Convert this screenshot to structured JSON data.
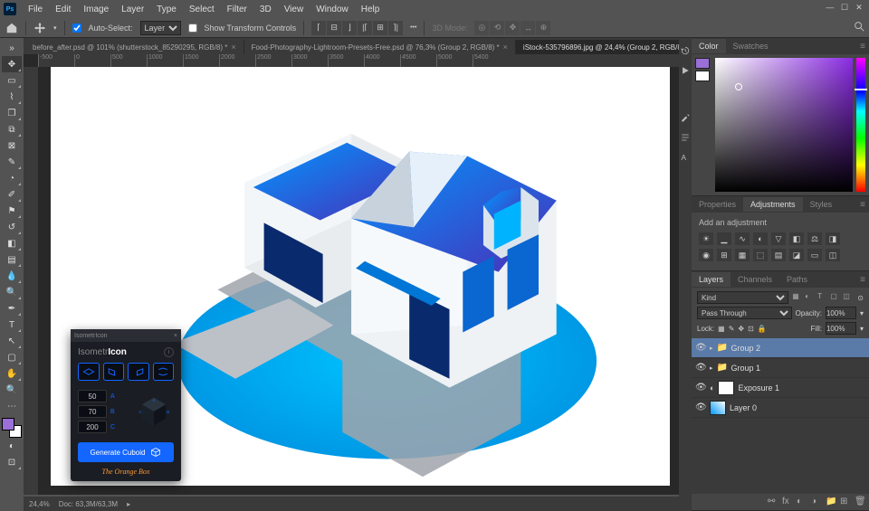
{
  "menu": {
    "items": [
      "File",
      "Edit",
      "Image",
      "Layer",
      "Type",
      "Select",
      "Filter",
      "3D",
      "View",
      "Window",
      "Help"
    ]
  },
  "options": {
    "auto_select": "Auto-Select:",
    "auto_select_mode": "Layer",
    "show_transform": "Show Transform Controls",
    "mode_3d": "3D Mode:"
  },
  "tabs": [
    {
      "label": "before_after.psd @ 101% (shutterstock_85290295, RGB/8) *",
      "active": false
    },
    {
      "label": "Food-Photography-Lightroom-Presets-Free.psd @ 76,3% (Group 2, RGB/8) *",
      "active": false
    },
    {
      "label": "iStock-535796896.jpg @ 24,4% (Group 2, RGB/8) *",
      "active": true
    }
  ],
  "ruler_ticks": [
    "-500",
    "0",
    "500",
    "1000",
    "1500",
    "2000",
    "2500",
    "3000",
    "3500",
    "4000",
    "4500",
    "5000",
    "5400"
  ],
  "plugin": {
    "header": "IsometrIcon",
    "title_light": "Isometr",
    "title_bold": "Icon",
    "dims": {
      "a": "50",
      "b": "70",
      "c": "200"
    },
    "labels": {
      "a": "A",
      "b": "B",
      "c": "C"
    },
    "generate": "Generate Cuboid",
    "footer": "The Orange Box"
  },
  "panels": {
    "color": {
      "tabs": [
        "Color",
        "Swatches"
      ],
      "active": 0
    },
    "adjustments": {
      "tabs": [
        "Properties",
        "Adjustments",
        "Styles"
      ],
      "active": 1,
      "label": "Add an adjustment"
    },
    "layers": {
      "tabs": [
        "Layers",
        "Channels",
        "Paths"
      ],
      "active": 0,
      "kind_label": "Kind",
      "blend_mode": "Pass Through",
      "opacity_label": "Opacity:",
      "opacity": "100%",
      "lock_label": "Lock:",
      "fill_label": "Fill:",
      "fill": "100%",
      "items": [
        {
          "type": "group",
          "name": "Group 2",
          "selected": true,
          "expanded": false
        },
        {
          "type": "group",
          "name": "Group 1",
          "selected": false,
          "expanded": false
        },
        {
          "type": "adj",
          "name": "Exposure 1",
          "selected": false
        },
        {
          "type": "layer",
          "name": "Layer 0",
          "selected": false
        }
      ]
    }
  },
  "status": {
    "zoom": "24,4%",
    "doc": "Doc: 63,3M/63,3M"
  },
  "colors": {
    "fg": "#9a6fd8",
    "bg": "#ffffff",
    "accent": "#1366ff"
  }
}
